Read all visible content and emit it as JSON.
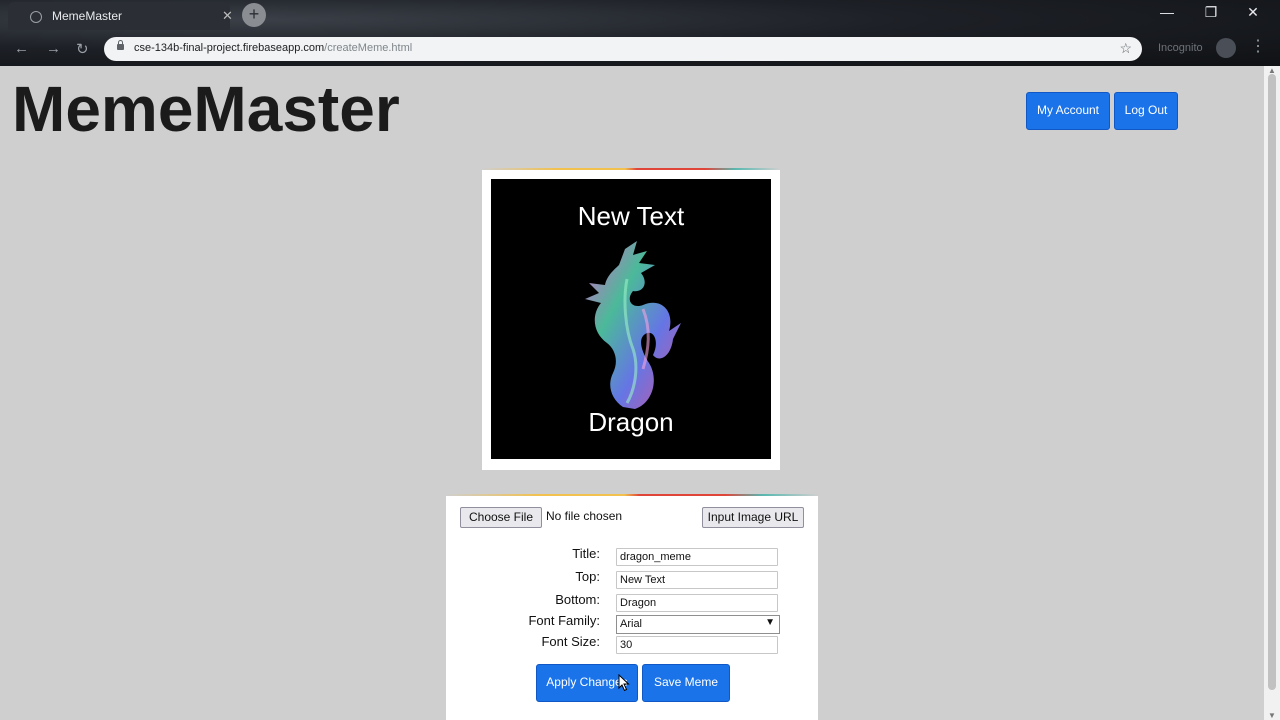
{
  "browser": {
    "tab_title": "MemeMaster",
    "url_host": "cse-134b-final-project.firebaseapp.com",
    "url_path": "/createMeme.html",
    "profile_name": "Incognito"
  },
  "header": {
    "site_title": "MemeMaster",
    "my_account_label": "My Account",
    "log_out_label": "Log Out"
  },
  "preview": {
    "top_text": "New Text",
    "bottom_text": "Dragon"
  },
  "form": {
    "choose_file_label": "Choose File",
    "file_status": "No file chosen",
    "input_url_label": "Input Image URL",
    "title_label": "Title:",
    "title_value": "dragon_meme",
    "top_label": "Top:",
    "top_value": "New Text",
    "bottom_label": "Bottom:",
    "bottom_value": "Dragon",
    "font_family_label": "Font Family:",
    "font_family_value": "Arial",
    "font_size_label": "Font Size:",
    "font_size_value": "30",
    "apply_label": "Apply Changes",
    "save_label": "Save Meme"
  },
  "colors": {
    "primary_button": "#1a73e8",
    "page_background": "#cfcfcf",
    "accent_yellow": "#f2c14e",
    "accent_red": "#e0453a",
    "accent_teal": "#57b8b0"
  }
}
